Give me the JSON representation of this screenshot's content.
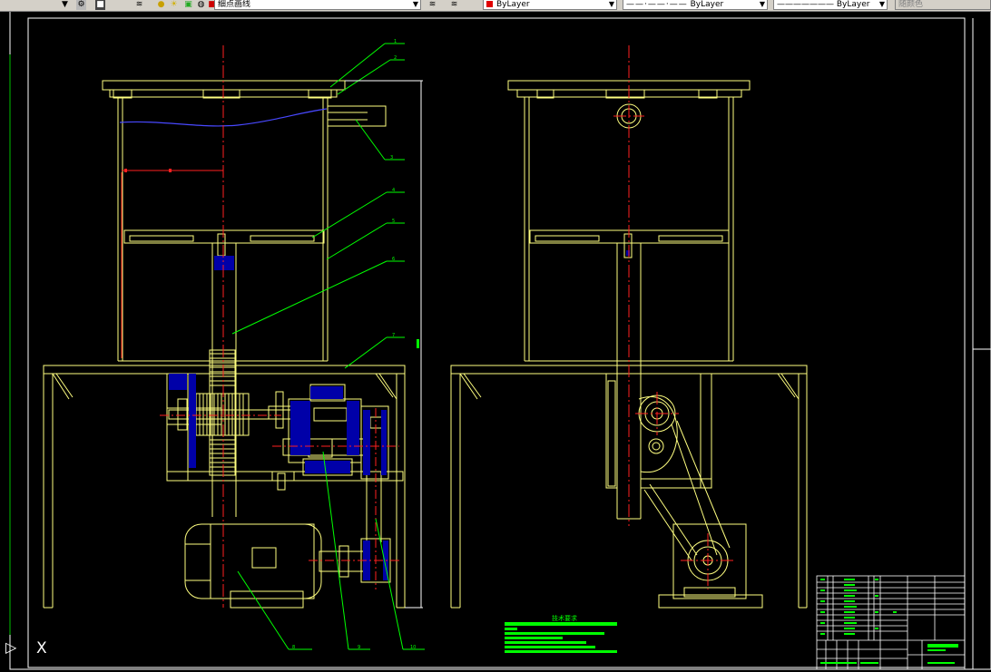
{
  "toolbar": {
    "linetype_current": "细点画线",
    "color_label": "ByLayer",
    "linetype_label": "ByLayer",
    "lineweight_label": "ByLayer",
    "plotstyle_label": "随颜色",
    "layer_color": "#e00000"
  },
  "callouts": [
    "1",
    "2",
    "3",
    "4",
    "5",
    "6",
    "7",
    "8",
    "9",
    "10"
  ],
  "tech_req_title": "技术要求",
  "colors": {
    "background": "#000000",
    "outline": "#ffff80",
    "centerline": "#ff2020",
    "leader": "#00ff00",
    "section": "#0000b0",
    "water": "#4040ff",
    "frame": "#ffffff"
  },
  "icons": [
    "layers-icon",
    "lightbulb-icon",
    "sun-icon",
    "lock-icon",
    "color-square-icon",
    "layer-previous-icon",
    "match-properties-icon",
    "ucs-icon"
  ]
}
